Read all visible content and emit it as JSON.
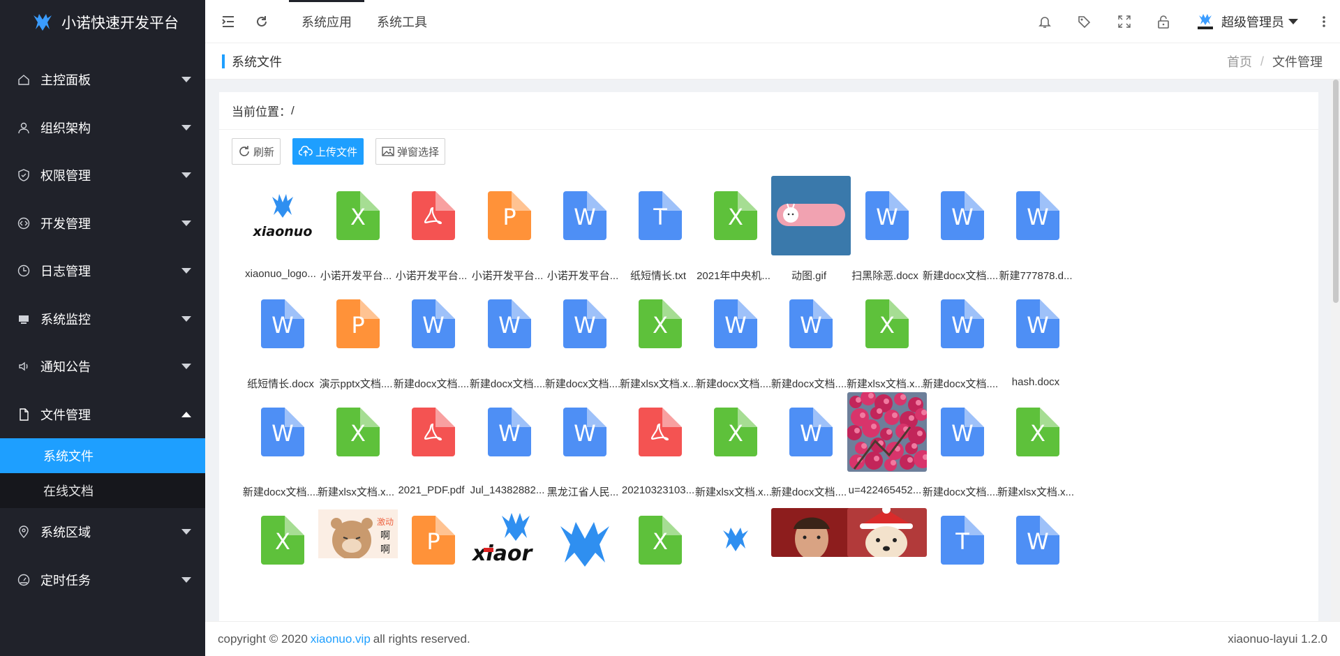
{
  "app": {
    "title": "小诺快速开发平台"
  },
  "nav": [
    {
      "label": "主控面板",
      "icon": "home-icon"
    },
    {
      "label": "组织架构",
      "icon": "user-icon"
    },
    {
      "label": "权限管理",
      "icon": "shield-icon"
    },
    {
      "label": "开发管理",
      "icon": "code-icon"
    },
    {
      "label": "日志管理",
      "icon": "clock-icon"
    },
    {
      "label": "系统监控",
      "icon": "monitor-icon"
    },
    {
      "label": "通知公告",
      "icon": "speaker-icon"
    },
    {
      "label": "文件管理",
      "icon": "file-icon"
    },
    {
      "label": "系统区域",
      "icon": "location-icon"
    },
    {
      "label": "定时任务",
      "icon": "gauge-icon"
    }
  ],
  "subnav": [
    {
      "label": "系统文件"
    },
    {
      "label": "在线文档"
    }
  ],
  "header": {
    "tabs": [
      "系统应用",
      "系统工具"
    ],
    "user": "超级管理员"
  },
  "titlebar": {
    "title": "系统文件",
    "crumb_home": "首页",
    "crumb_sep": "/",
    "crumb_current": "文件管理"
  },
  "location": {
    "label": "当前位置：",
    "path": "/"
  },
  "toolbar": {
    "refresh": "刷新",
    "upload": "上传文件",
    "select": "弹窗选择"
  },
  "files": [
    {
      "name": "xiaonuo_logo...",
      "kind": "logo"
    },
    {
      "name": "小诺开发平台...",
      "kind": "x"
    },
    {
      "name": "小诺开发平台...",
      "kind": "pdf"
    },
    {
      "name": "小诺开发平台...",
      "kind": "p"
    },
    {
      "name": "小诺开发平台...",
      "kind": "w"
    },
    {
      "name": "纸短情长.txt",
      "kind": "t"
    },
    {
      "name": "2021年中央机...",
      "kind": "x"
    },
    {
      "name": "动图.gif",
      "kind": "gif"
    },
    {
      "name": "扫黑除恶.docx",
      "kind": "w"
    },
    {
      "name": "新建docx文档....",
      "kind": "w"
    },
    {
      "name": "新建777878.d...",
      "kind": "w"
    },
    {
      "name": "纸短情长.docx",
      "kind": "w"
    },
    {
      "name": "演示pptx文档....",
      "kind": "p"
    },
    {
      "name": "新建docx文档....",
      "kind": "w"
    },
    {
      "name": "新建docx文档....",
      "kind": "w"
    },
    {
      "name": "新建docx文档....",
      "kind": "w"
    },
    {
      "name": "新建xlsx文档.x...",
      "kind": "x"
    },
    {
      "name": "新建docx文档....",
      "kind": "w"
    },
    {
      "name": "新建docx文档....",
      "kind": "w"
    },
    {
      "name": "新建xlsx文档.x...",
      "kind": "x"
    },
    {
      "name": "新建docx文档....",
      "kind": "w"
    },
    {
      "name": "hash.docx",
      "kind": "w"
    },
    {
      "name": "新建docx文档....",
      "kind": "w"
    },
    {
      "name": "新建xlsx文档.x...",
      "kind": "x"
    },
    {
      "name": "2021_PDF.pdf",
      "kind": "pdf"
    },
    {
      "name": "Jul_14382882...",
      "kind": "w"
    },
    {
      "name": "黑龙江省人民...",
      "kind": "w"
    },
    {
      "name": "20210323103...",
      "kind": "pdf"
    },
    {
      "name": "新建xlsx文档.x...",
      "kind": "x"
    },
    {
      "name": "新建docx文档....",
      "kind": "w"
    },
    {
      "name": "u=422465452...",
      "kind": "flower"
    },
    {
      "name": "新建docx文档....",
      "kind": "w"
    },
    {
      "name": "新建xlsx文档.x...",
      "kind": "x"
    },
    {
      "name": "",
      "kind": "x"
    },
    {
      "name": "",
      "kind": "bear"
    },
    {
      "name": "",
      "kind": "p"
    },
    {
      "name": "",
      "kind": "logo-big"
    },
    {
      "name": "",
      "kind": "logo-mark"
    },
    {
      "name": "",
      "kind": "x"
    },
    {
      "name": "",
      "kind": "logo-small"
    },
    {
      "name": "",
      "kind": "man"
    },
    {
      "name": "",
      "kind": "dog"
    },
    {
      "name": "",
      "kind": "t"
    },
    {
      "name": "",
      "kind": "w"
    }
  ],
  "footer": {
    "copy": "copyright © 2020",
    "link": "xiaonuo.vip",
    "rights": "all rights reserved.",
    "version": "xiaonuo-layui 1.2.0"
  },
  "colors": {
    "accent": "#1e9fff",
    "sidebar": "#20222a"
  }
}
